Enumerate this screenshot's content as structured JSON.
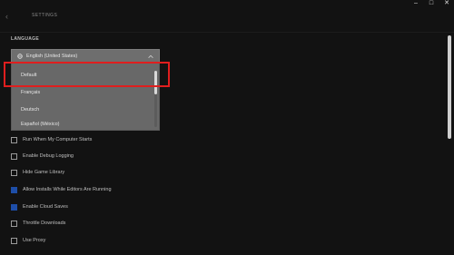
{
  "header": {
    "title": "SETTINGS"
  },
  "window_controls": {
    "minimize": "–",
    "maximize": "□",
    "close": "✕"
  },
  "language": {
    "section_label": "LANGUAGE",
    "selected": "English (United States)",
    "options": [
      "Default",
      "Français",
      "Deutsch",
      "Español (México)"
    ]
  },
  "options": [
    {
      "label": "Run When My Computer Starts",
      "checked": false
    },
    {
      "label": "Enable Debug Logging",
      "checked": false
    },
    {
      "label": "Hide Game Library",
      "checked": false
    },
    {
      "label": "Allow Installs While Editors Are Running",
      "checked": true
    },
    {
      "label": "Enable Cloud Saves",
      "checked": true
    },
    {
      "label": "Throttle Downloads",
      "checked": false
    },
    {
      "label": "Use Proxy",
      "checked": false
    }
  ],
  "colors": {
    "accent": "#1e4ea8",
    "highlight": "#e01e1e"
  }
}
